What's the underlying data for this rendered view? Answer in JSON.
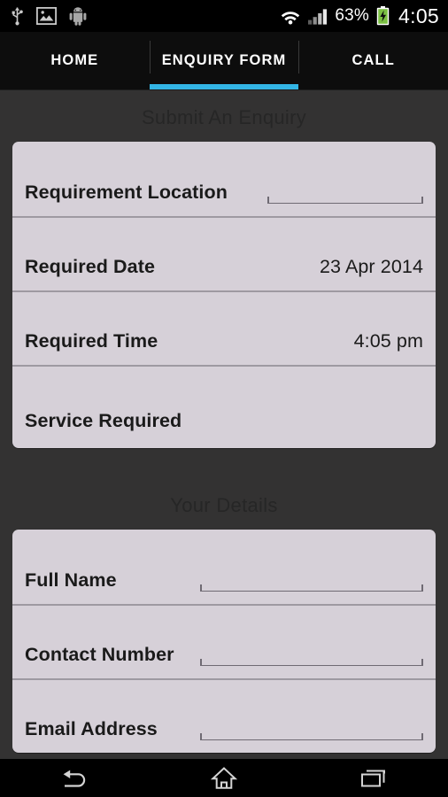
{
  "status_bar": {
    "left_icons": [
      "usb-icon",
      "gallery-image-icon",
      "android-robot-icon"
    ],
    "wifi_icon": "wifi-icon",
    "signal_icon": "cellular-signal-icon",
    "battery_percent": "63%",
    "battery_icon": "battery-charging-icon",
    "time": "4:05"
  },
  "tabs": [
    {
      "label": "HOME",
      "active": false
    },
    {
      "label": "ENQUIRY FORM",
      "active": true
    },
    {
      "label": "CALL",
      "active": false
    }
  ],
  "accent_color": "#33b5e5",
  "card_color": "#d6d0d8",
  "background_color": "#333232",
  "sections": [
    {
      "title": "Submit An Enquiry",
      "rows": [
        {
          "label": "Requirement Location",
          "type": "input",
          "value": ""
        },
        {
          "label": "Required Date",
          "type": "value",
          "value": "23 Apr 2014"
        },
        {
          "label": "Required Time",
          "type": "value",
          "value": "4:05 pm"
        },
        {
          "label": "Service Required",
          "type": "picker",
          "value": ""
        }
      ]
    },
    {
      "title": "Your Details",
      "rows": [
        {
          "label": "Full Name",
          "type": "input",
          "value": ""
        },
        {
          "label": "Contact Number",
          "type": "input",
          "value": ""
        },
        {
          "label": "Email Address",
          "type": "input",
          "value": ""
        }
      ]
    }
  ],
  "nav_bar": {
    "back": "back-icon",
    "home": "home-icon",
    "recents": "recents-icon"
  }
}
